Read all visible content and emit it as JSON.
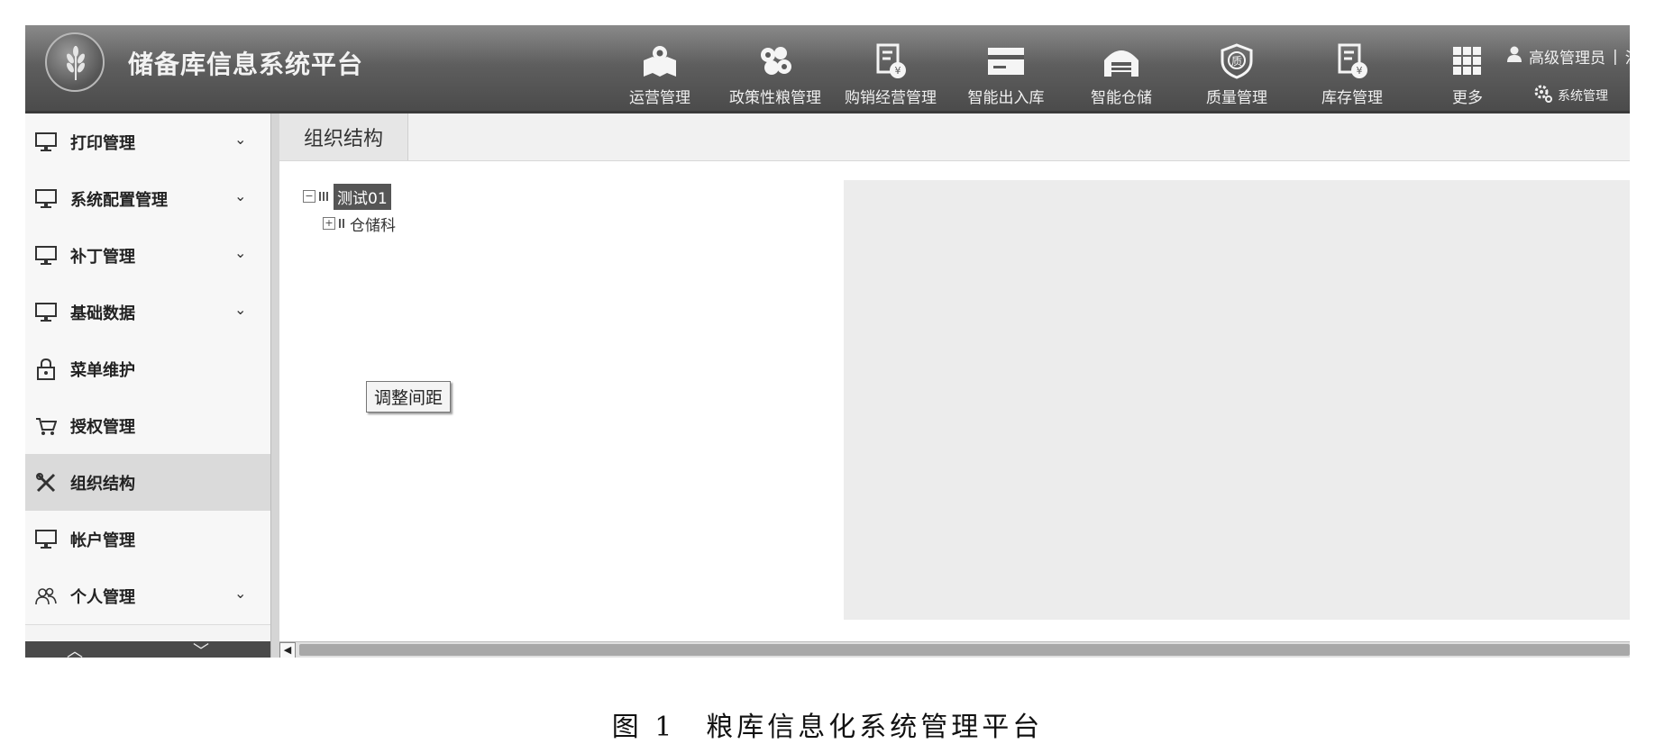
{
  "header": {
    "app_title": "储备库信息系统平台",
    "nav": [
      {
        "label": "运营管理",
        "icon": "map-pin-icon"
      },
      {
        "label": "政策性粮管理",
        "icon": "grain-cluster-icon"
      },
      {
        "label": "购销经营管理",
        "icon": "document-coin-icon"
      },
      {
        "label": "智能出入库",
        "icon": "card-icon"
      },
      {
        "label": "智能仓储",
        "icon": "warehouse-icon"
      },
      {
        "label": "质量管理",
        "icon": "quality-shield-icon"
      },
      {
        "label": "库存管理",
        "icon": "inventory-document-icon"
      },
      {
        "label": "更多",
        "icon": "grid-icon"
      }
    ],
    "user": {
      "name": "高级管理员",
      "separator": "|",
      "extra": "注"
    },
    "system_link": "系统管理"
  },
  "sidebar": {
    "items": [
      {
        "label": "打印管理",
        "icon": "monitor-icon",
        "expandable": true
      },
      {
        "label": "系统配置管理",
        "icon": "monitor-icon",
        "expandable": true
      },
      {
        "label": "补丁管理",
        "icon": "monitor-icon",
        "expandable": true
      },
      {
        "label": "基础数据",
        "icon": "monitor-icon",
        "expandable": true
      },
      {
        "label": "菜单维护",
        "icon": "lock-icon",
        "expandable": false
      },
      {
        "label": "授权管理",
        "icon": "cart-icon",
        "expandable": false
      },
      {
        "label": "组织结构",
        "icon": "tools-icon",
        "expandable": false,
        "active": true
      },
      {
        "label": "帐户管理",
        "icon": "monitor-icon",
        "expandable": false
      },
      {
        "label": "个人管理",
        "icon": "people-icon",
        "expandable": true
      }
    ],
    "chevron": "⌄"
  },
  "content": {
    "tab_label": "组织结构",
    "tree": {
      "root": {
        "label": "测试01",
        "expanded": true
      },
      "children": [
        {
          "label": "仓储科",
          "expanded": false
        }
      ]
    },
    "tooltip_button": "调整间距"
  },
  "caption": "图 1　粮库信息化系统管理平台"
}
